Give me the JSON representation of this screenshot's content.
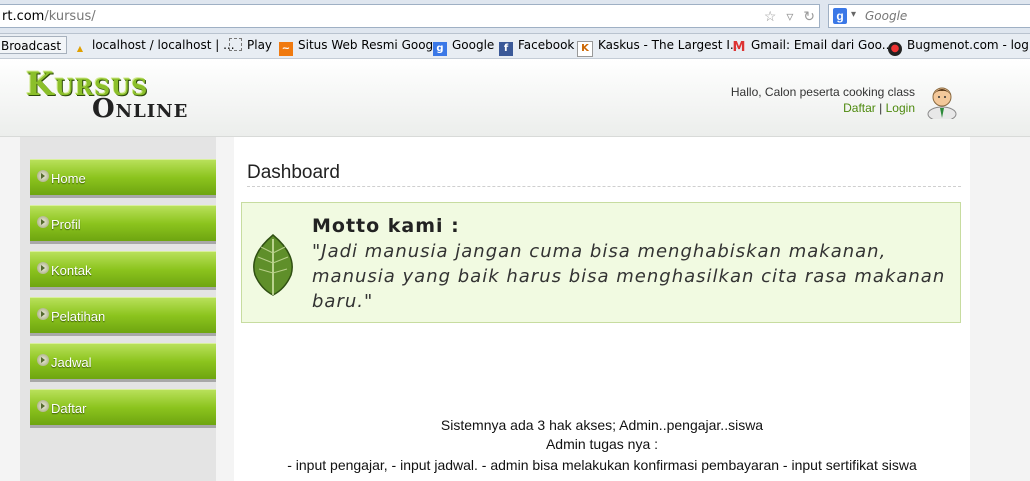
{
  "browser": {
    "url_host_partial": "rt.com",
    "url_path": "/kursus/",
    "search_placeholder": "Google",
    "search_logo": "g-logo-icon"
  },
  "bookmarks": [
    {
      "label": "Broadcast ...",
      "icon": "none"
    },
    {
      "label": "localhost / localhost | ...",
      "icon": "pma-icon"
    },
    {
      "label": "Play",
      "icon": "blank-page-icon"
    },
    {
      "label": "Situs Web Resmi Goog...",
      "icon": "chart-icon"
    },
    {
      "label": "Google",
      "icon": "google-icon"
    },
    {
      "label": "Facebook",
      "icon": "facebook-icon"
    },
    {
      "label": "Kaskus - The Largest I...",
      "icon": "kaskus-icon"
    },
    {
      "label": "Gmail: Email dari Goo...",
      "icon": "gmail-icon"
    },
    {
      "label": "Bugmenot.com - logi...",
      "icon": "bugmenot-icon"
    }
  ],
  "header": {
    "logo_line1": "Kursus",
    "logo_line2": "Online",
    "greeting": "Hallo, Calon peserta cooking class",
    "register_link": "Daftar",
    "separator": "|",
    "login_link": "Login"
  },
  "sidebar": {
    "items": [
      {
        "label": "Home"
      },
      {
        "label": "Profil"
      },
      {
        "label": "Kontak"
      },
      {
        "label": "Pelatihan"
      },
      {
        "label": "Jadwal"
      },
      {
        "label": "Daftar"
      }
    ]
  },
  "main": {
    "title": "Dashboard",
    "motto_title": "Motto kami :",
    "motto_text": "\"Jadi manusia jangan cuma bisa menghabiskan makanan, manusia yang baik harus bisa menghasilkan cita rasa makanan baru.\"",
    "paragraphs": [
      "Sistemnya ada 3 hak akses; Admin..pengajar..siswa",
      "Admin tugas nya :",
      "- input pengajar, - input jadwal. - admin bisa melakukan konfirmasi pembayaran - input sertifikat siswa"
    ]
  },
  "colors": {
    "menu_green": "#8cc41e",
    "link_green": "#4e8a0e",
    "motto_bg": "#f1fae1"
  }
}
